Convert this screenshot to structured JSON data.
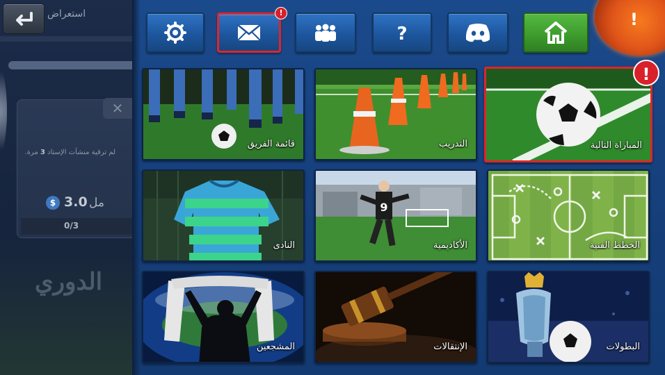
{
  "left_panel": {
    "back_label": "استعراض",
    "upgrade_text_pre": "لم ترقية منشآت الإستاد",
    "upgrade_count": "3",
    "upgrade_text_post": "مرة.",
    "currency_symbol": "$",
    "price_value": "3.0",
    "price_unit": "مل",
    "progress": "0/3",
    "league_title": "الدوري"
  },
  "top_buttons": [
    {
      "name": "settings",
      "icon": "gear-icon",
      "alert": false
    },
    {
      "name": "messages",
      "icon": "envelope-icon",
      "alert": true,
      "badge": "!"
    },
    {
      "name": "community",
      "icon": "people-icon",
      "alert": false
    },
    {
      "name": "help",
      "icon": "question-icon",
      "alert": false,
      "glyph": "?"
    },
    {
      "name": "discord",
      "icon": "discord-icon",
      "alert": false
    },
    {
      "name": "home",
      "icon": "home-icon",
      "alert": false
    }
  ],
  "corner_alert": "!",
  "tiles": [
    {
      "label": "المباراة التالية",
      "alert": true,
      "badge": "!"
    },
    {
      "label": "التدريب",
      "alert": false
    },
    {
      "label": "قائمة الفريق",
      "alert": false
    },
    {
      "label": "الخطط الفنية",
      "alert": false
    },
    {
      "label": "الأكاديمية",
      "alert": false
    },
    {
      "label": "النادى",
      "alert": false
    },
    {
      "label": "البطولات",
      "alert": false
    },
    {
      "label": "الإنتقالات",
      "alert": false
    },
    {
      "label": "المشجعين",
      "alert": false
    }
  ],
  "colors": {
    "accent_blue": "#1d569e",
    "alert_red": "#e0252b",
    "home_green": "#3c9a2c",
    "orb_orange": "#e0551a"
  }
}
